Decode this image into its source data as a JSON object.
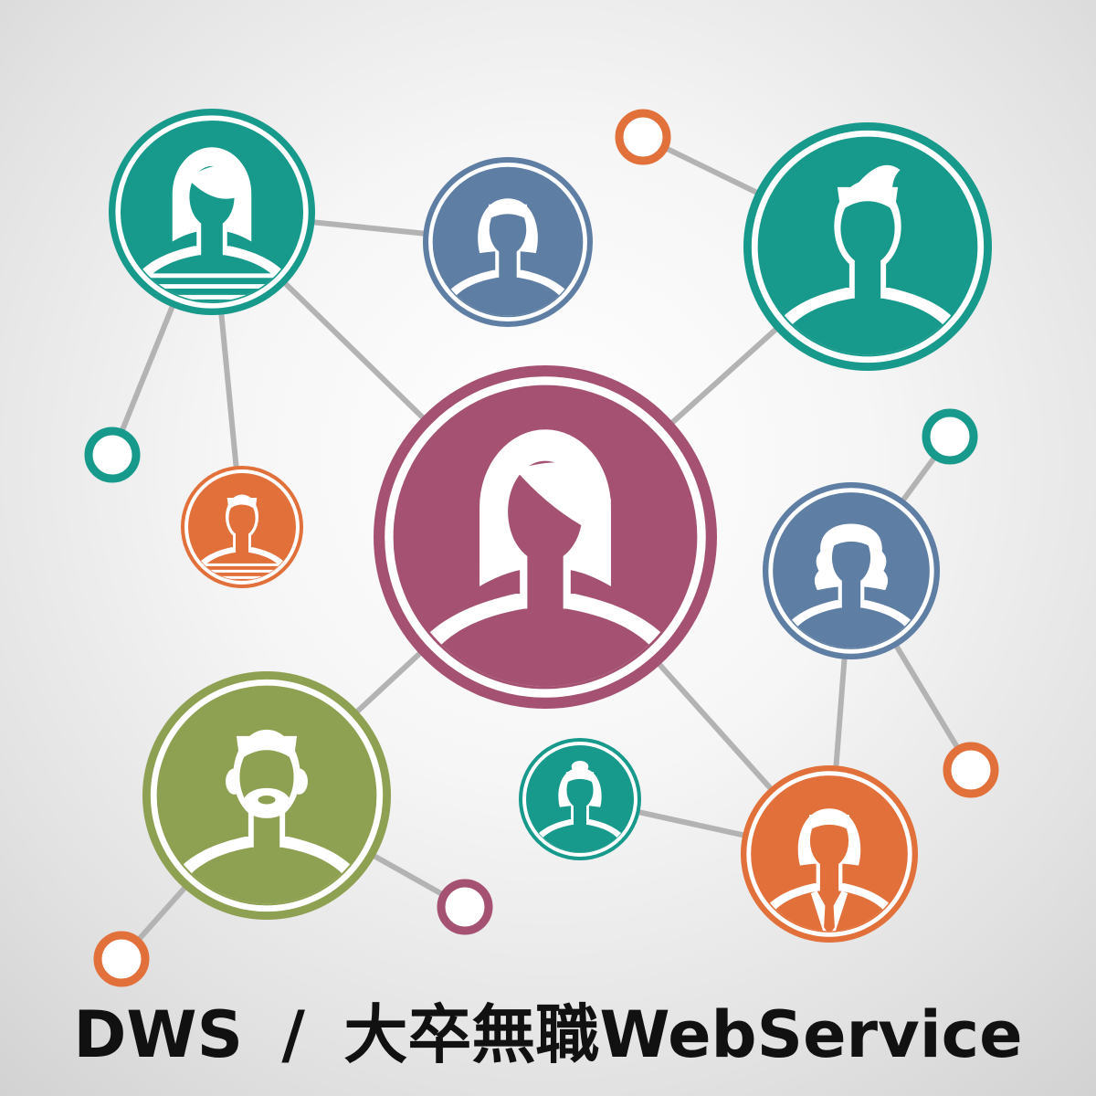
{
  "title": "DWS / 大卒無職WebService",
  "colors": {
    "teal": "#17998b",
    "blue": "#5e7ea3",
    "magenta": "#a55272",
    "orange": "#e2703a",
    "olive": "#8ea052",
    "line": "#b3b3b3",
    "text": "#111111"
  },
  "avatars": [
    {
      "icon": "woman-avatar-icon",
      "color": "teal"
    },
    {
      "icon": "woman-avatar-icon",
      "color": "blue"
    },
    {
      "icon": "man-avatar-icon",
      "color": "teal"
    },
    {
      "icon": "woman-avatar-icon",
      "color": "magenta"
    },
    {
      "icon": "child-avatar-icon",
      "color": "orange"
    },
    {
      "icon": "woman-avatar-icon",
      "color": "blue"
    },
    {
      "icon": "bearded-man-avatar-icon",
      "color": "olive"
    },
    {
      "icon": "woman-avatar-icon",
      "color": "teal"
    },
    {
      "icon": "businesswoman-avatar-icon",
      "color": "orange"
    }
  ],
  "nodes": [
    {
      "icon": "node-ring-icon",
      "color": "orange"
    },
    {
      "icon": "node-ring-icon",
      "color": "teal"
    },
    {
      "icon": "node-ring-icon",
      "color": "teal"
    },
    {
      "icon": "node-ring-icon",
      "color": "orange"
    },
    {
      "icon": "node-ring-icon",
      "color": "magenta"
    },
    {
      "icon": "node-ring-icon",
      "color": "orange"
    }
  ]
}
